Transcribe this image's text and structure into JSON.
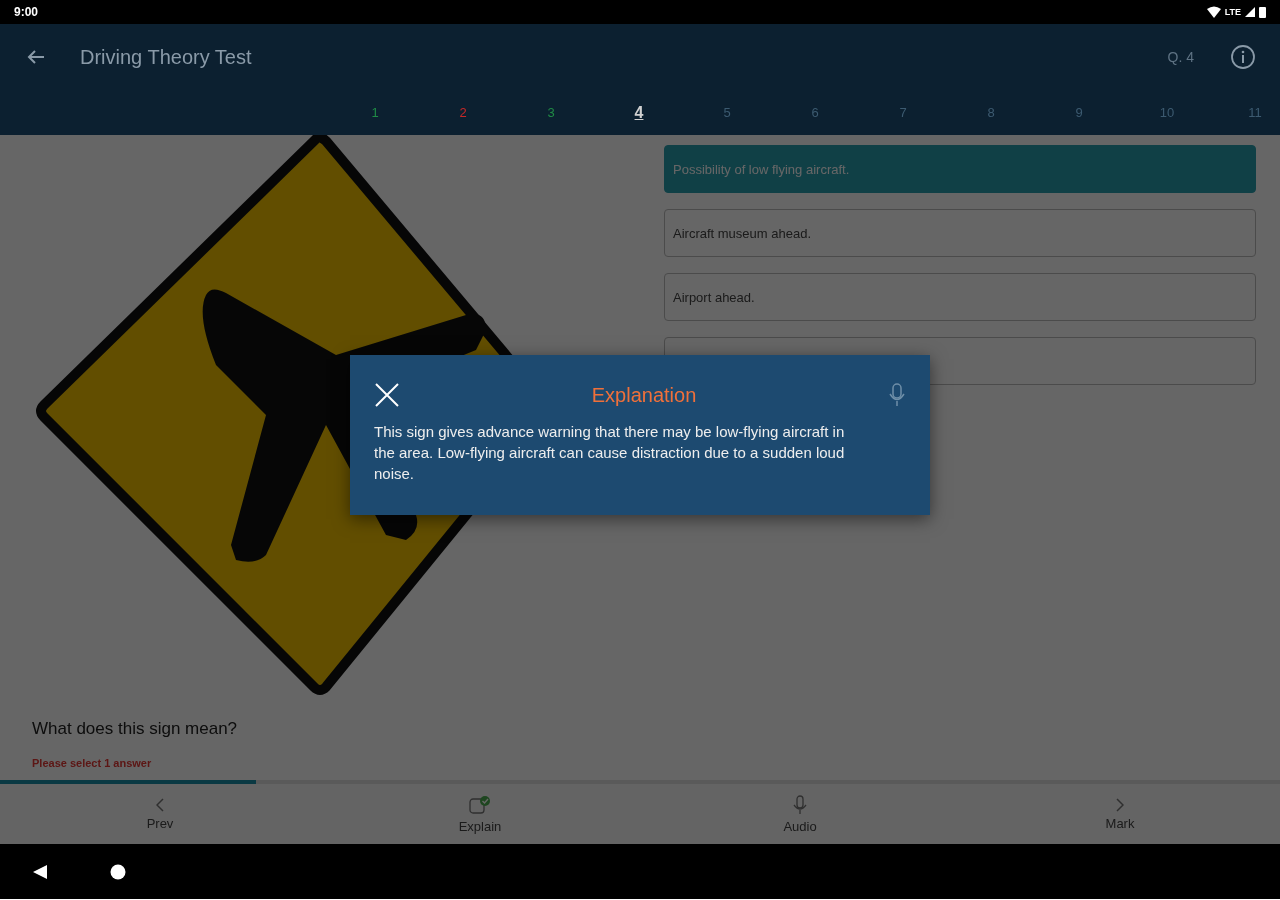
{
  "status_bar": {
    "time": "9:00",
    "network": "LTE"
  },
  "app_bar": {
    "title": "Driving Theory Test",
    "question_label": "Q. 4"
  },
  "question_numbers": [
    {
      "label": "1",
      "color": "#1f8a45",
      "selected": false
    },
    {
      "label": "2",
      "color": "#c62828",
      "selected": false
    },
    {
      "label": "3",
      "color": "#1f8a45",
      "selected": false
    },
    {
      "label": "4",
      "color": "#d0d0d0",
      "selected": true
    },
    {
      "label": "5",
      "color": "#3c5a70",
      "selected": false
    },
    {
      "label": "6",
      "color": "#3c5a70",
      "selected": false
    },
    {
      "label": "7",
      "color": "#3c5a70",
      "selected": false
    },
    {
      "label": "8",
      "color": "#3c5a70",
      "selected": false
    },
    {
      "label": "9",
      "color": "#3c5a70",
      "selected": false
    },
    {
      "label": "10",
      "color": "#3c5a70",
      "selected": false
    },
    {
      "label": "11",
      "color": "#3c5a70",
      "selected": false
    }
  ],
  "answers": [
    {
      "label": "Possibility of low flying aircraft.",
      "selected": true
    },
    {
      "label": "Aircraft museum ahead.",
      "selected": false
    },
    {
      "label": "Airport ahead.",
      "selected": false
    },
    {
      "selected": false
    }
  ],
  "question": {
    "text": "What does this sign mean?",
    "hint": "Please select 1 answer"
  },
  "progress": {
    "level": 0.2
  },
  "bottom_nav": [
    {
      "label": "Prev",
      "kind": "prev"
    },
    {
      "label": "Explain",
      "kind": "explain"
    },
    {
      "label": "Audio",
      "kind": "audio"
    },
    {
      "label": "Mark",
      "kind": "next"
    }
  ],
  "dialog": {
    "title": "Explanation",
    "body": "This sign gives advance warning that there may be low-flying aircraft in the area. Low-flying aircraft can cause distraction due to a sudden loud noise."
  }
}
